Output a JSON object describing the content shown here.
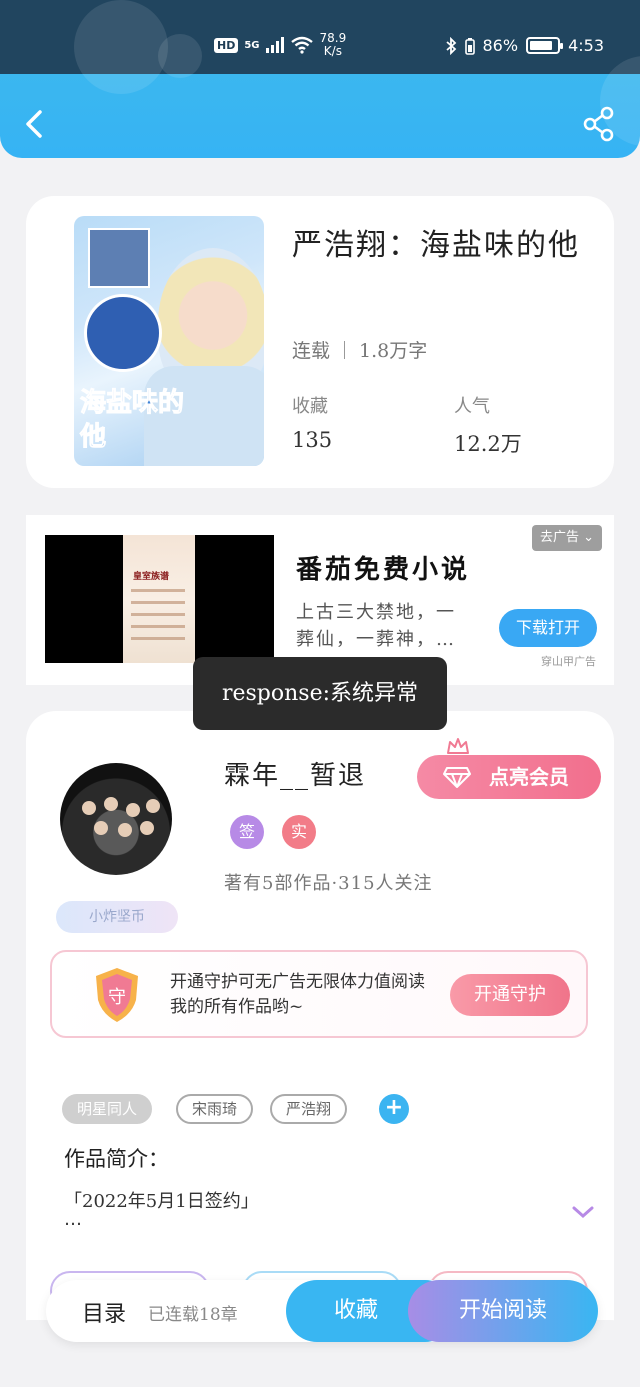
{
  "status_bar": {
    "hd": "HD",
    "network": "5G",
    "speed_value": "78.9",
    "speed_unit": "K/s",
    "battery_percent": "86%",
    "time": "4:53"
  },
  "header": {
    "back_icon": "chevron-left-icon",
    "share_icon": "share-icon"
  },
  "book": {
    "title": "严浩翔：海盐味的他",
    "status": "连载",
    "word_count": "1.8万字",
    "favorites_label": "收藏",
    "favorites_value": "135",
    "popularity_label": "人气",
    "popularity_value": "12.2万",
    "cover_text": "海盐味的他"
  },
  "ad": {
    "close_label": "去广告",
    "app_name": "番茄免费小说",
    "description": "上古三大禁地，一葬仙，一葬神，…",
    "download_label": "下载打开",
    "source_label": "穿山甲广告",
    "poster_title": "皇室族谱"
  },
  "toast": {
    "message": "response:系统异常"
  },
  "author": {
    "name": "霖年__暂退",
    "vip_label": "点亮会员",
    "badges": [
      "签",
      "实"
    ],
    "stats": "著有5部作品·315人关注",
    "fan_label": "小炸坚币"
  },
  "guard": {
    "shield_label": "守",
    "text": "开通守护可无广告无限体力值阅读我的所有作品哟~",
    "button_label": "开通守护"
  },
  "tags": [
    "明星同人",
    "宋雨琦",
    "严浩翔"
  ],
  "intro": {
    "label": "作品简介：",
    "text": "「2022年5月1日签约」",
    "more": "…"
  },
  "bottom_bar": {
    "toc_label": "目录",
    "toc_status": "已连载18章",
    "favorite_label": "收藏",
    "read_label": "开始阅读"
  },
  "colors": {
    "accent_blue": "#39b6f2",
    "vip_pink": "#f26f8d",
    "badge_purple": "#b78ae6",
    "badge_red": "#f27c88"
  }
}
